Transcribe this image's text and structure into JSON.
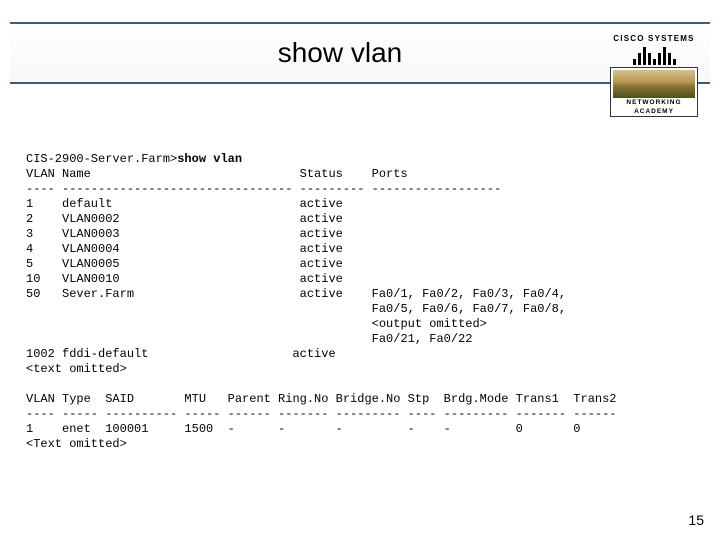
{
  "title": "show vlan",
  "logo": {
    "brand": "CISCO SYSTEMS",
    "division1": "NETWORKING",
    "division2": "ACADEMY"
  },
  "chart_data": {
    "type": "table",
    "prompt": "CIS-2900-Server.Farm>",
    "command": "show vlan",
    "vlan_table": {
      "headers": [
        "VLAN",
        "Name",
        "Status",
        "Ports"
      ],
      "rows": [
        {
          "vlan": "1",
          "name": "default",
          "status": "active",
          "ports": ""
        },
        {
          "vlan": "2",
          "name": "VLAN0002",
          "status": "active",
          "ports": ""
        },
        {
          "vlan": "3",
          "name": "VLAN0003",
          "status": "active",
          "ports": ""
        },
        {
          "vlan": "4",
          "name": "VLAN0004",
          "status": "active",
          "ports": ""
        },
        {
          "vlan": "5",
          "name": "VLAN0005",
          "status": "active",
          "ports": ""
        },
        {
          "vlan": "10",
          "name": "VLAN0010",
          "status": "active",
          "ports": ""
        },
        {
          "vlan": "50",
          "name": "Sever.Farm",
          "status": "active",
          "ports": "Fa0/1, Fa0/2, Fa0/3, Fa0/4, Fa0/5, Fa0/6, Fa0/7, Fa0/8, <output omitted> Fa0/21, Fa0/22"
        },
        {
          "vlan": "1002",
          "name": "fddi-default",
          "status": "active",
          "ports": ""
        }
      ],
      "note_after_50": "<output omitted>",
      "note_after_1002": "<text omitted>"
    },
    "type_table": {
      "headers": [
        "VLAN",
        "Type",
        "SAID",
        "MTU",
        "Parent",
        "Ring.No",
        "Bridge.No",
        "Stp",
        "Brdg.Mode",
        "Trans1",
        "Trans2"
      ],
      "rows": [
        {
          "vlan": "1",
          "type": "enet",
          "said": "100001",
          "mtu": "1500",
          "parent": "-",
          "ringno": "-",
          "bridgeno": "-",
          "stp": "-",
          "brdgmode": "-",
          "trans1": "0",
          "trans2": "0"
        }
      ],
      "note_after": "<Text omitted>"
    }
  },
  "lines": {
    "l0a": "CIS-2900-Server.Farm>",
    "l0b": "show vlan",
    "l1": "VLAN Name                             Status    Ports",
    "l2": "---- -------------------------------- --------- ------------------",
    "l3": "1    default                          active",
    "l4": "2    VLAN0002                         active",
    "l5": "3    VLAN0003                         active",
    "l6": "4    VLAN0004                         active",
    "l7": "5    VLAN0005                         active",
    "l8": "10   VLAN0010                         active",
    "l9": "50   Sever.Farm                       active    Fa0/1, Fa0/2, Fa0/3, Fa0/4,",
    "l10": "                                                Fa0/5, Fa0/6, Fa0/7, Fa0/8,",
    "l11": "                                                <output omitted>",
    "l12": "                                                Fa0/21, Fa0/22",
    "l13": "1002 fddi-default                    active",
    "l14": "<text omitted>",
    "l15": "",
    "l16": "VLAN Type  SAID       MTU   Parent Ring.No Bridge.No Stp  Brdg.Mode Trans1  Trans2",
    "l17": "---- ----- ---------- ----- ------ ------- --------- ---- --------- ------- ------",
    "l18": "1    enet  100001     1500  -      -       -         -    -         0       0",
    "l19": "<Text omitted>"
  },
  "page_number": "15"
}
